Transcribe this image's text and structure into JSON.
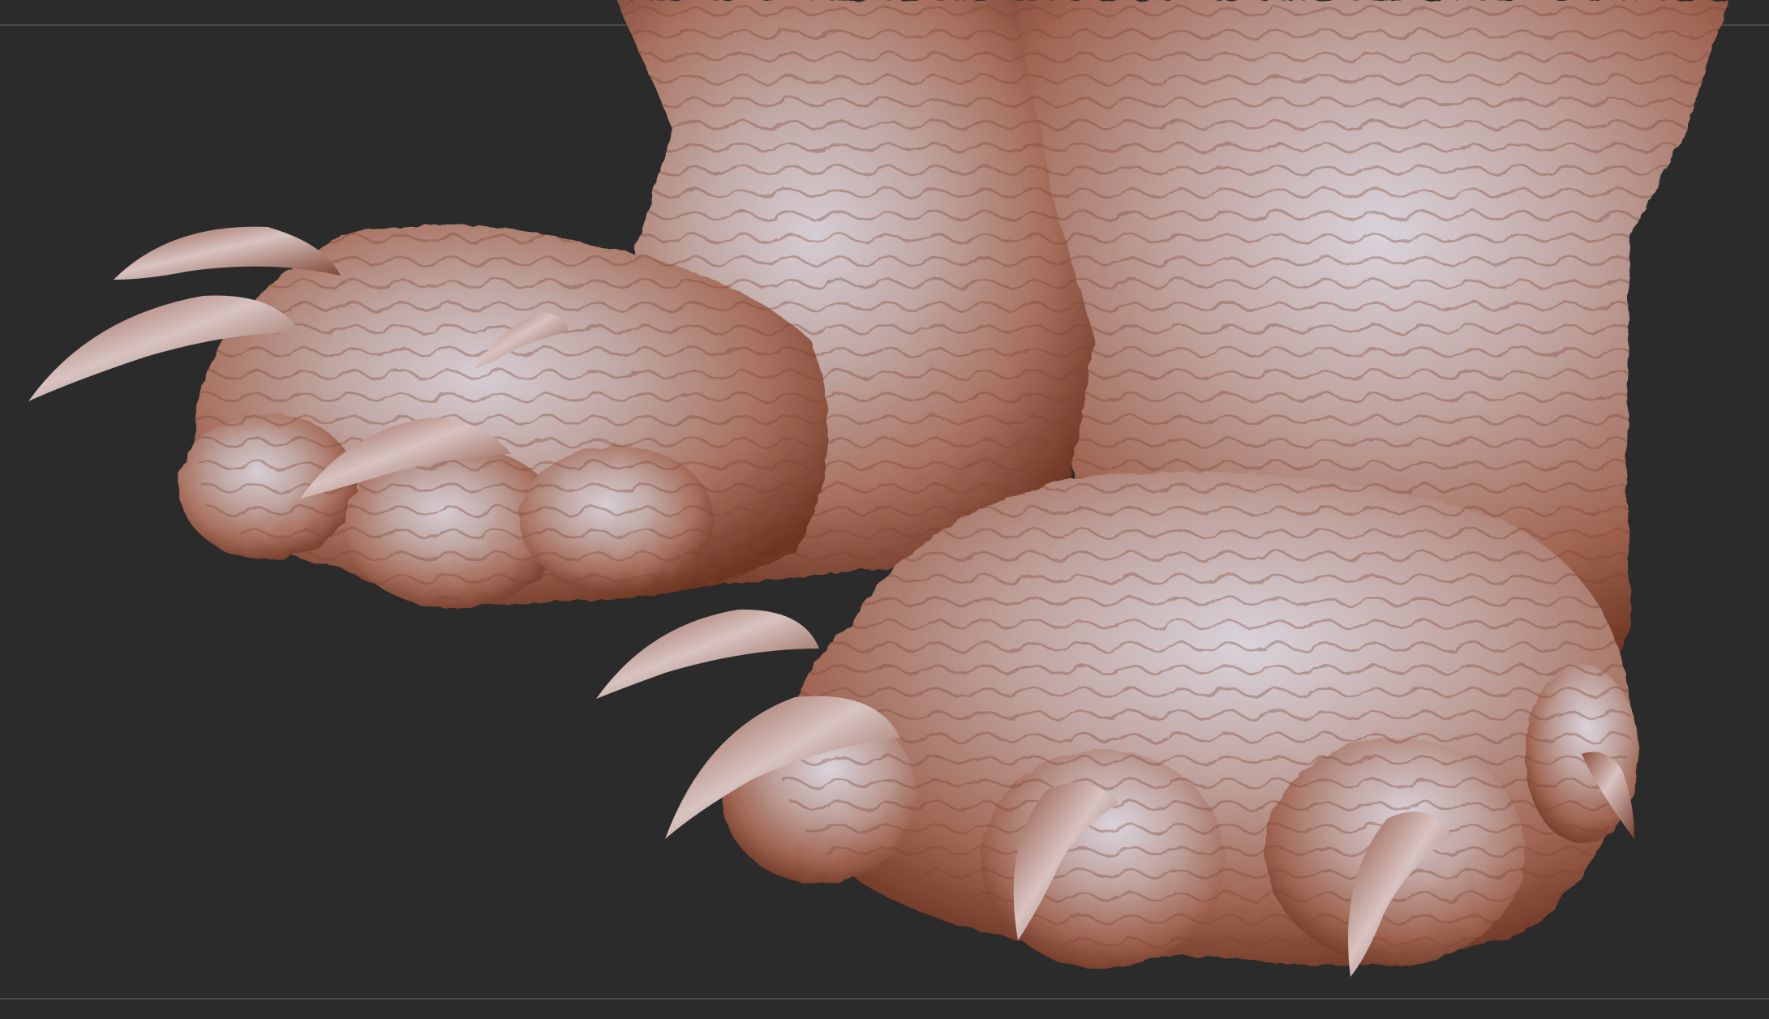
{
  "viewport": {
    "background_color": "#2b2b2b",
    "frame_line_color": "#4a4a4a"
  },
  "model": {
    "subject": "sculpted-creature-feet-icon",
    "skin_color": "#b58676",
    "skin_highlight": "#c9c7d2",
    "skin_shadow": "#7a3f2c",
    "claw_color": "#9c6655"
  }
}
